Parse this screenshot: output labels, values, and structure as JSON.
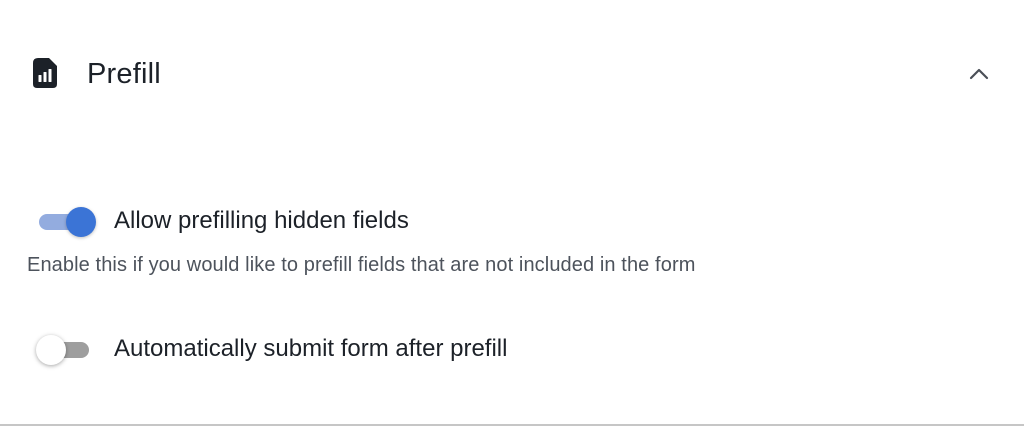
{
  "section": {
    "title": "Prefill",
    "icon": "sim-card-icon",
    "collapse_icon": "chevron-up-icon"
  },
  "options": [
    {
      "label": "Allow prefilling hidden fields",
      "enabled": true,
      "description": "Enable this if you would like to prefill fields that are not included in the form"
    },
    {
      "label": "Automatically submit form after prefill",
      "enabled": false
    }
  ],
  "colors": {
    "toggle_on_knob": "#3b74d6",
    "toggle_on_track": "#93acdf",
    "toggle_off_track": "#9e9e9e",
    "text_primary": "#1c2128",
    "text_secondary": "#4d535c"
  }
}
